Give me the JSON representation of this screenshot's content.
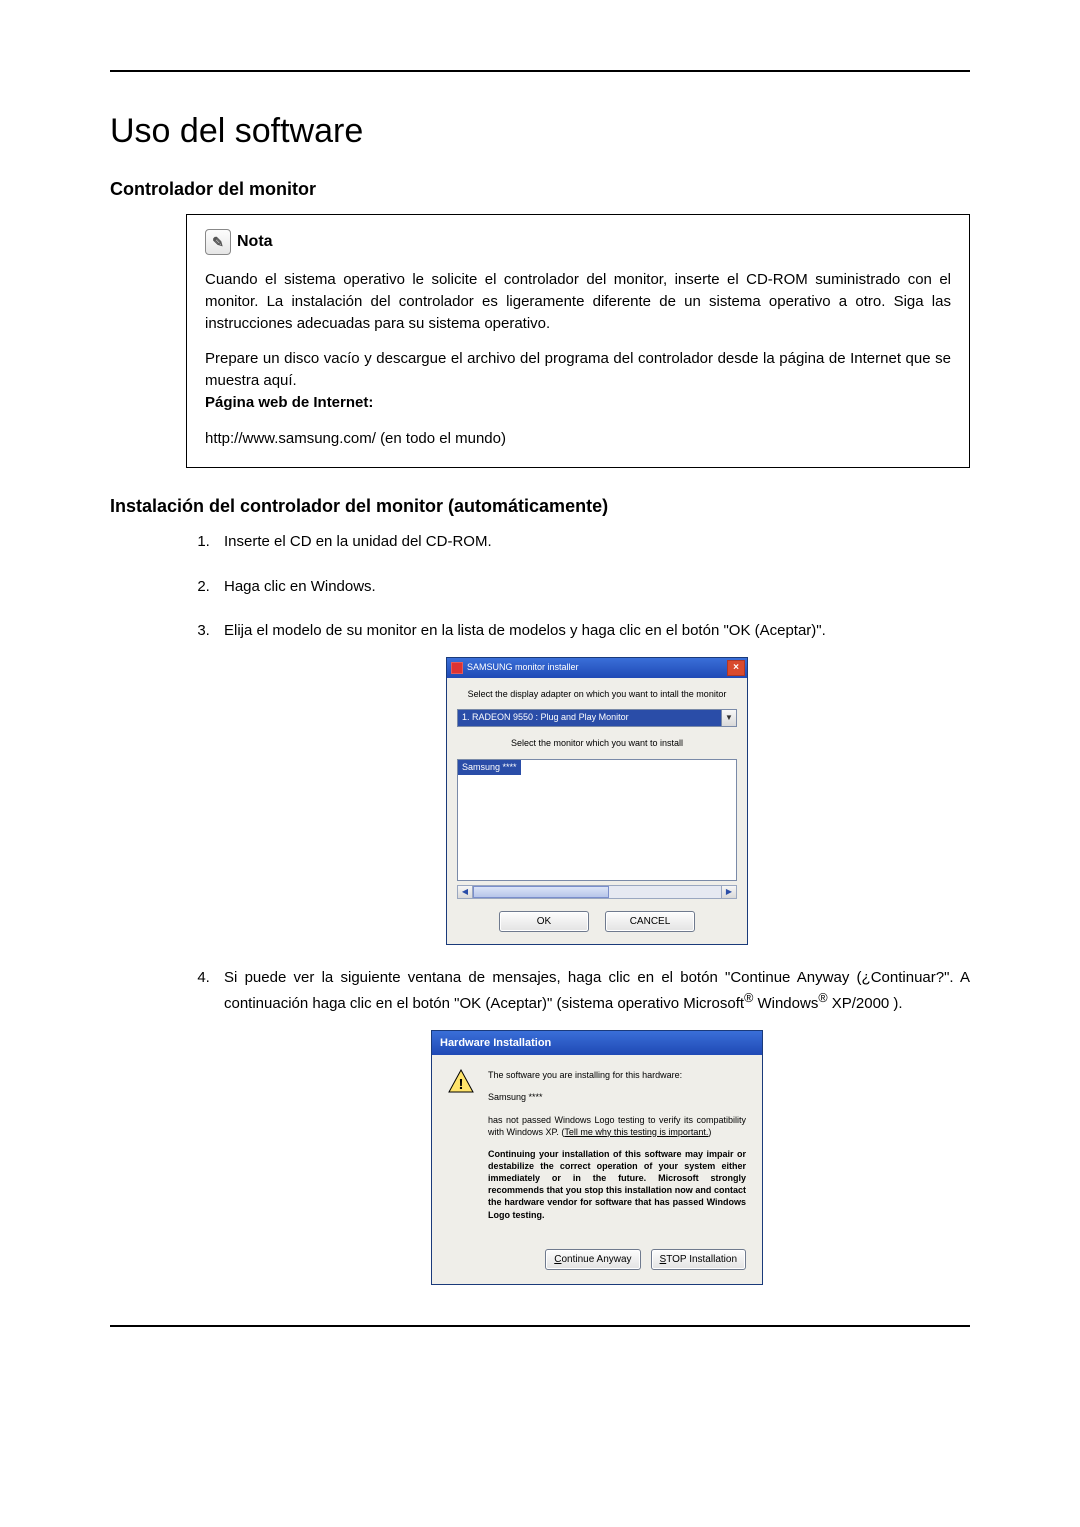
{
  "page_title": "Uso del software",
  "section_subtitle": "Controlador del monitor",
  "note": {
    "label": "Nota",
    "p1": "Cuando el sistema operativo le solicite el controlador del monitor, inserte el CD-ROM suministrado con el monitor. La instalación del controlador es ligeramente diferente de un sistema operativo a otro. Siga las instrucciones adecuadas para su sistema operativo.",
    "p2": "Prepare un disco vacío y descargue el archivo del programa del controlador desde la página de Internet que se muestra aquí.",
    "p3_label": "Página web de Internet:",
    "url": "http://www.samsung.com/ (en todo el mundo)"
  },
  "install_heading": "Instalación del controlador del monitor (automáticamente)",
  "steps": {
    "s1": "Inserte el CD en la unidad del CD-ROM.",
    "s2": "Haga clic en Windows.",
    "s3": "Elija el modelo de su monitor en la lista de modelos y haga clic en el botón \"OK (Aceptar)\".",
    "s4_a": "Si puede ver la siguiente ventana de mensajes, haga clic en el botón \"Continue Anyway (¿Continuar?\". A continuación haga clic en el botón \"OK (Aceptar)\" (sistema operativo Microsoft",
    "s4_b": " Windows",
    "s4_c": " XP/2000 )."
  },
  "dialog1": {
    "title": "SAMSUNG monitor installer",
    "label_adapter": "Select the display adapter on which you want to intall the monitor",
    "dropdown_selected": "1. RADEON 9550 : Plug and Play Monitor",
    "label_monitor": "Select the monitor which you want to install",
    "list_selected": "Samsung ****",
    "btn_ok": "OK",
    "btn_cancel": "CANCEL"
  },
  "dialog2": {
    "title": "Hardware Installation",
    "line1": "The software you are installing for this hardware:",
    "line2": "Samsung ****",
    "line3_a": "has not passed Windows Logo testing to verify its compatibility with Windows XP. (",
    "line3_link": "Tell me why this testing is important.",
    "line3_b": ")",
    "bold_msg": "Continuing your installation of this software may impair or destabilize the correct operation of your system either immediately or in the future. Microsoft strongly recommends that you stop this installation now and contact the hardware vendor for software that has passed Windows Logo testing.",
    "btn_continue_u": "C",
    "btn_continue_rest": "ontinue Anyway",
    "btn_stop_u": "S",
    "btn_stop_rest": "TOP Installation"
  }
}
